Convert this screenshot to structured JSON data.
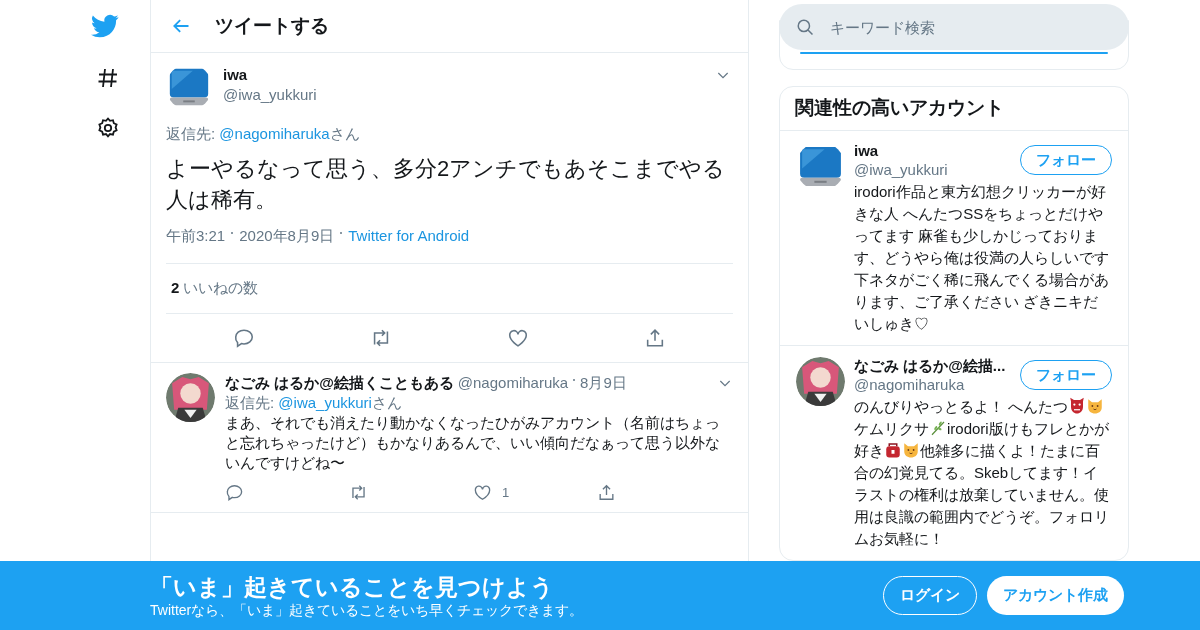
{
  "header": {
    "title": "ツイートする"
  },
  "tweet": {
    "name": "iwa",
    "handle": "@iwa_yukkuri",
    "reply_prefix": "返信先: ",
    "reply_to": "@nagomiharuka",
    "reply_suffix": "さん",
    "text": "よーやるなって思う、多分2アンチでもあそこまでやる人は稀有。",
    "time": "午前3:21",
    "date": "2020年8月9日",
    "source": "Twitter for Android",
    "likes_count": "2",
    "likes_label": "いいねの数"
  },
  "replies": [
    {
      "name": "なごみ はるか@絵描くこともある",
      "handle": "@nagomiharuka",
      "date": "8月9日",
      "reply_prefix": "返信先: ",
      "reply_to": "@iwa_yukkuri",
      "reply_suffix": "さん",
      "text": "まあ、それでも消えたり動かなくなったひがみアカウント（名前はちょっと忘れちゃったけど）もかなりあるんで、いい傾向だなぁって思う以外ないんですけどね〜",
      "like_count": "1"
    }
  ],
  "search": {
    "placeholder": "キーワード検索"
  },
  "related": {
    "title": "関連性の高いアカウント",
    "accounts": [
      {
        "name": "iwa",
        "handle": "@iwa_yukkuri",
        "follow": "フォロー",
        "bio": [
          {
            "kind": "text",
            "text": "irodori作品と東方幻想クリッカーが好きな人 へんたつSSをちょっとだけやってます 麻雀も少しかじっております、どうやら俺は役満の人らしいです下ネタがごく稀に飛んでくる場合があります、ご了承ください ざきニキだいしゅき♡"
          }
        ]
      },
      {
        "name": "なごみ はるか@絵描...",
        "handle": "@nagomiharuka",
        "follow": "フォロー",
        "bio": [
          {
            "kind": "text",
            "text": "のんびりやっとるよ！ へんたつ"
          },
          {
            "kind": "ogre"
          },
          {
            "kind": "cat"
          },
          {
            "kind": "text",
            "text": "ケムリクサ"
          },
          {
            "kind": "sprig"
          },
          {
            "kind": "text",
            "text": "irodori版けもフレとかが好き"
          },
          {
            "kind": "bag"
          },
          {
            "kind": "cat"
          },
          {
            "kind": "text",
            "text": "他雑多に描くよ！たまに百合の幻覚見てる。Skebしてます！イラストの権利は放棄していません。使用は良識の範囲内でどうぞ。フォロリムお気軽に！"
          }
        ]
      }
    ]
  },
  "banner": {
    "title": "「いま」起きていることを見つけよう",
    "subtitle": "Twitterなら、「いま」起きていることをいち早くチェックできます。",
    "login": "ログイン",
    "signup": "アカウント作成"
  }
}
